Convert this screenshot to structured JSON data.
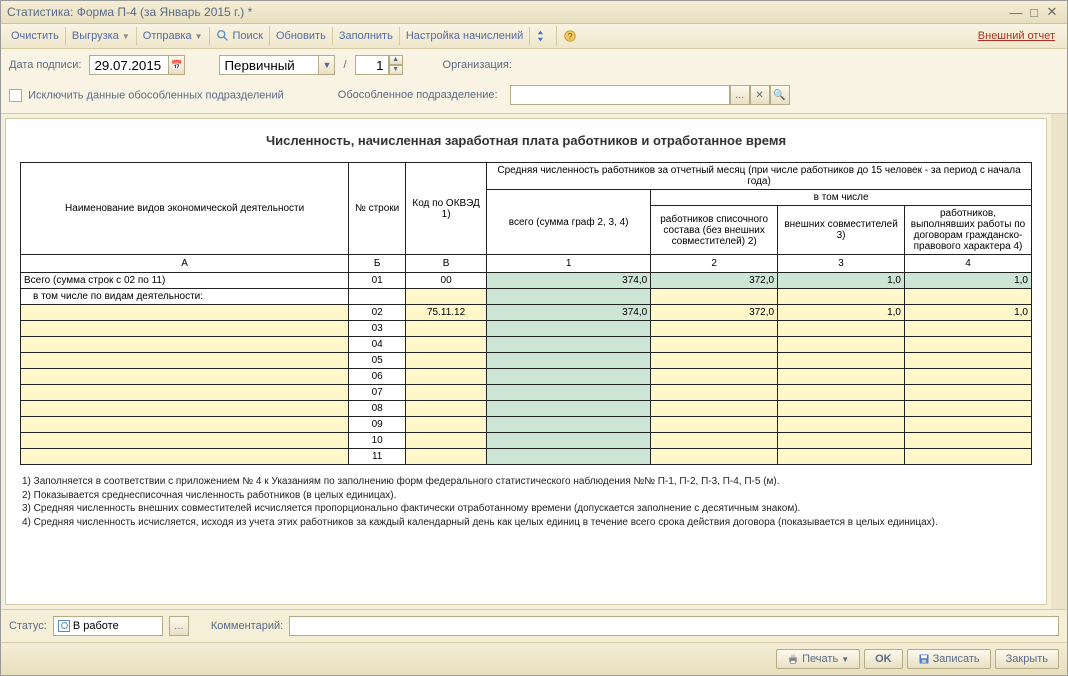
{
  "window": {
    "title": "Статистика: Форма П-4 (за Январь 2015 г.) *"
  },
  "toolbar": {
    "clear": "Очистить",
    "export": "Выгрузка",
    "send": "Отправка",
    "search": "Поиск",
    "refresh": "Обновить",
    "fill": "Заполнить",
    "settings": "Настройка начислений",
    "external_report": "Внешний отчет"
  },
  "params": {
    "date_label": "Дата подписи:",
    "date_value": "29.07.2015",
    "type_value": "Первичный",
    "slash": "/",
    "num_value": "1",
    "org_label": "Организация:",
    "exclude_label": "Исключить данные обособленных подразделений",
    "subdivision_label": "Обособленное подразделение:"
  },
  "doc": {
    "title": "Численность, начисленная заработная плата работников и отработанное время",
    "headers": {
      "name": "Наименование видов экономической деятельности",
      "row_no": "№ строки",
      "code": "Код по ОКВЭД 1)",
      "group": "Средняя численность работников за отчетный месяц (при числе работников до 15 человек - за период с начала года)",
      "total": "всего (сумма граф 2, 3, 4)",
      "including": "в том числе",
      "c2": "работников списочного состава (без внешних совместителей) 2)",
      "c3": "внешних совместителей 3)",
      "c4": "работников, выполнявших работы по договорам гражданско-правового характера 4)",
      "letters": {
        "a": "А",
        "b": "Б",
        "v": "В",
        "n1": "1",
        "n2": "2",
        "n3": "3",
        "n4": "4"
      }
    },
    "totals_row": {
      "name": "Всего (сумма строк с 02 по 11)",
      "no": "01",
      "code": "00",
      "v1": "374,0",
      "v2": "372,0",
      "v3": "1,0",
      "v4": "1,0"
    },
    "subtitle": "в том числе по видам деятельности:",
    "data_row": {
      "no": "02",
      "code": "75.11.12",
      "v1": "374,0",
      "v2": "372,0",
      "v3": "1,0",
      "v4": "1,0"
    },
    "empty_rows": [
      "03",
      "04",
      "05",
      "06",
      "07",
      "08",
      "09",
      "10",
      "11"
    ],
    "footnotes": {
      "f1": "1) Заполняется в соответствии с приложением № 4 к Указаниям по заполнению форм федерального статистического наблюдения №№ П-1, П-2, П-3, П-4, П-5 (м).",
      "f2": "2) Показывается среднесписочная численность работников (в целых единицах).",
      "f3": "3) Средняя численность внешних совместителей исчисляется пропорционально фактически отработанному времени (допускается заполнение с десятичным знаком).",
      "f4": "4) Средняя численность исчисляется, исходя из учета этих работников за каждый календарный день как целых единиц в течение всего срока действия договора (показывается в целых единицах)."
    }
  },
  "status": {
    "label": "Статус:",
    "value": "В работе",
    "comment_label": "Комментарий:"
  },
  "bottom": {
    "print": "Печать",
    "ok": "OK",
    "save": "Записать",
    "close": "Закрыть"
  }
}
